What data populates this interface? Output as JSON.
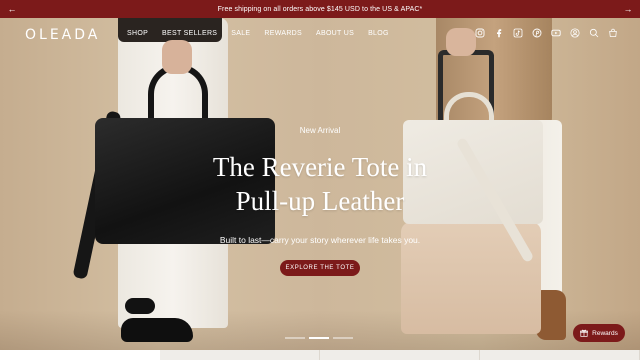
{
  "announcement": {
    "text": "Free shipping on all orders above $145 USD to the US & APAC*"
  },
  "header": {
    "logo": "OLEADA",
    "nav": [
      "SHOP",
      "BEST SELLERS",
      "SALE",
      "REWARDS",
      "ABOUT US",
      "BLOG"
    ],
    "icons": [
      "instagram-icon",
      "facebook-icon",
      "tiktok-icon",
      "pinterest-icon",
      "youtube-icon",
      "account-icon",
      "search-icon",
      "cart-icon"
    ]
  },
  "hero": {
    "kicker": "New Arrival",
    "headline_line1": "The Reverie Tote in",
    "headline_line2": "Pull-up Leather",
    "subtext": "Built to last—carry your story wherever life takes you.",
    "cta": "EXPLORE THE TOTE"
  },
  "carousel": {
    "slides": 3,
    "active": 2
  },
  "rewards_button": {
    "label": "Rewards"
  },
  "colors": {
    "brand": "#7c1a1a",
    "text": "#ffffff"
  }
}
